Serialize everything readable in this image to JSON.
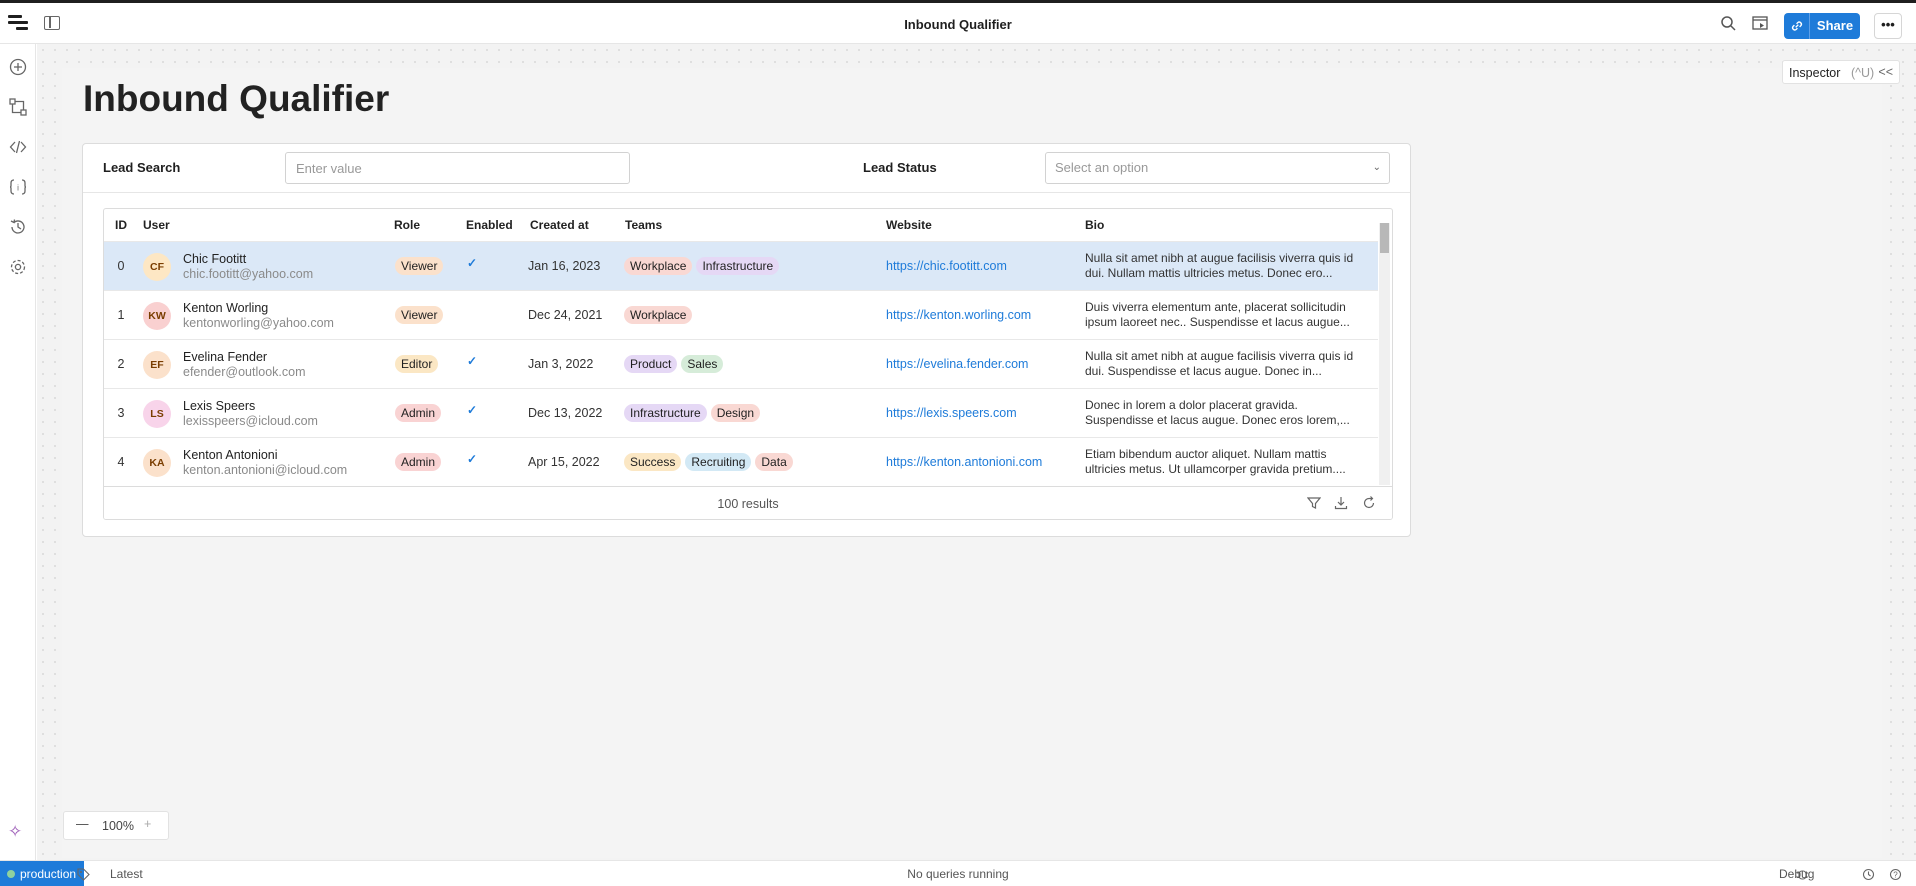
{
  "app": {
    "title": "Inbound Qualifier",
    "share_label": "Share",
    "more_label": "•••"
  },
  "page": {
    "heading": "Inbound Qualifier"
  },
  "filters": {
    "lead_search_label": "Lead Search",
    "lead_search_placeholder": "Enter value",
    "lead_status_label": "Lead Status",
    "lead_status_placeholder": "Select an option"
  },
  "table": {
    "columns": [
      "ID",
      "User",
      "Role",
      "Enabled",
      "Created at",
      "Teams",
      "Website",
      "Bio"
    ],
    "rows": [
      {
        "id": "0",
        "initials": "CF",
        "avatar_color": "#fde7c4",
        "name": "Chic Footitt",
        "email": "chic.footitt@yahoo.com",
        "role": "Viewer",
        "role_color": "#fbe1cb",
        "enabled": true,
        "created": "Jan 16, 2023",
        "teams": [
          {
            "label": "Workplace",
            "color": "#f9d8d3"
          },
          {
            "label": "Infrastructure",
            "color": "#e5d8f5"
          }
        ],
        "website": "https://chic.footitt.com",
        "bio": "Nulla sit amet nibh at augue facilisis viverra quis id dui. Nullam mattis ultricies metus. Donec ero..."
      },
      {
        "id": "1",
        "initials": "KW",
        "avatar_color": "#f9d0d0",
        "name": "Kenton Worling",
        "email": "kentonworling@yahoo.com",
        "role": "Viewer",
        "role_color": "#fbe1cb",
        "enabled": false,
        "created": "Dec 24, 2021",
        "teams": [
          {
            "label": "Workplace",
            "color": "#f9d8d3"
          }
        ],
        "website": "https://kenton.worling.com",
        "bio": "Duis viverra elementum ante, placerat sollicitudin ipsum laoreet nec.. Suspendisse et lacus augue..."
      },
      {
        "id": "2",
        "initials": "EF",
        "avatar_color": "#fbe1cb",
        "name": "Evelina Fender",
        "email": "efender@outlook.com",
        "role": "Editor",
        "role_color": "#fbe7c4",
        "enabled": true,
        "created": "Jan 3, 2022",
        "teams": [
          {
            "label": "Product",
            "color": "#e5d8f5"
          },
          {
            "label": "Sales",
            "color": "#d6ecd9"
          }
        ],
        "website": "https://evelina.fender.com",
        "bio": "Nulla sit amet nibh at augue facilisis viverra quis id dui. Suspendisse et lacus augue. Donec in..."
      },
      {
        "id": "3",
        "initials": "LS",
        "avatar_color": "#f8d4ea",
        "name": "Lexis Speers",
        "email": "lexisspeers@icloud.com",
        "role": "Admin",
        "role_color": "#f9d3d3",
        "enabled": true,
        "created": "Dec 13, 2022",
        "teams": [
          {
            "label": "Infrastructure",
            "color": "#e5d8f5"
          },
          {
            "label": "Design",
            "color": "#f9d8d3"
          }
        ],
        "website": "https://lexis.speers.com",
        "bio": "Donec in lorem a dolor placerat gravida. Suspendisse et lacus augue. Donec eros lorem,..."
      },
      {
        "id": "4",
        "initials": "KA",
        "avatar_color": "#fbe1cb",
        "name": "Kenton Antonioni",
        "email": "kenton.antonioni@icloud.com",
        "role": "Admin",
        "role_color": "#f9d3d3",
        "enabled": true,
        "created": "Apr 15, 2022",
        "teams": [
          {
            "label": "Success",
            "color": "#fbe7c4"
          },
          {
            "label": "Recruiting",
            "color": "#d3e9f5"
          },
          {
            "label": "Data",
            "color": "#f9d8d3"
          }
        ],
        "website": "https://kenton.antonioni.com",
        "bio": "Etiam bibendum auctor aliquet. Nullam mattis ultricies metus. Ut ullamcorper gravida pretium...."
      }
    ],
    "results_label": "100 results"
  },
  "inspector": {
    "label": "Inspector",
    "shortcut": "(^U)",
    "collapse": "<<"
  },
  "zoom": {
    "minus": "—",
    "value": "100%",
    "plus": "+"
  },
  "statusbar": {
    "environment": "production",
    "version": "Latest",
    "queries": "No queries running",
    "debug": "Debug"
  },
  "colors": {
    "accent": "#1e7bd9",
    "selected_row": "#dbe8f7"
  },
  "icons": {
    "rail": [
      "add-icon",
      "workflow-icon",
      "code-icon",
      "variables-icon",
      "history-icon",
      "settings-icon"
    ],
    "topbar": [
      "app-logo-icon",
      "panel-toggle-icon",
      "search-icon",
      "preview-icon",
      "link-icon"
    ]
  }
}
